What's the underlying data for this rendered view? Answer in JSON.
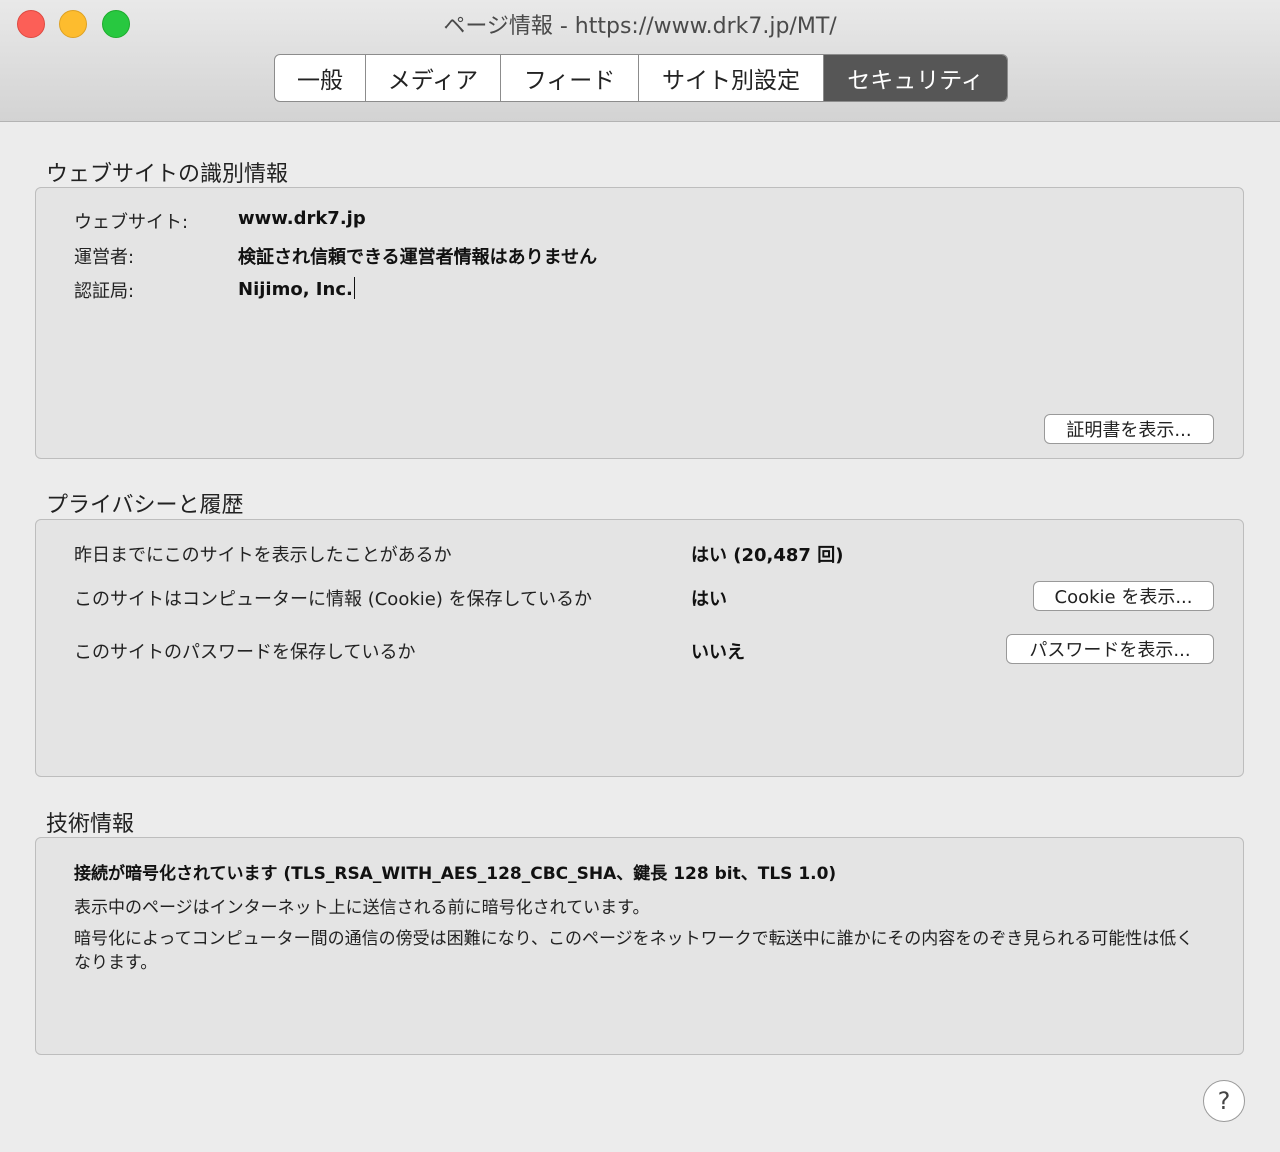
{
  "window": {
    "title": "ページ情報 - https://www.drk7.jp/MT/"
  },
  "tabs": [
    {
      "label": "一般",
      "active": false
    },
    {
      "label": "メディア",
      "active": false
    },
    {
      "label": "フィード",
      "active": false
    },
    {
      "label": "サイト別設定",
      "active": false
    },
    {
      "label": "セキュリティ",
      "active": true
    }
  ],
  "identity": {
    "title": "ウェブサイトの識別情報",
    "website_label": "ウェブサイト:",
    "website_value": "www.drk7.jp",
    "owner_label": "運営者:",
    "owner_value": "検証され信頼できる運営者情報はありません",
    "issuer_label": "認証局:",
    "issuer_value": "Nijimo, Inc.",
    "view_cert_button": "証明書を表示..."
  },
  "privacy": {
    "title": "プライバシーと履歴",
    "visited_question": "昨日までにこのサイトを表示したことがあるか",
    "visited_answer": "はい (20,487 回)",
    "cookie_question": "このサイトはコンピューターに情報 (Cookie) を保存しているか",
    "cookie_answer": "はい",
    "cookie_button": "Cookie を表示...",
    "password_question": "このサイトのパスワードを保存しているか",
    "password_answer": "いいえ",
    "password_button": "パスワードを表示..."
  },
  "technical": {
    "title": "技術情報",
    "headline": "接続が暗号化されています (TLS_RSA_WITH_AES_128_CBC_SHA、鍵長 128 bit、TLS 1.0)",
    "line1": "表示中のページはインターネット上に送信される前に暗号化されています。",
    "line2": "暗号化によってコンピューター間の通信の傍受は困難になり、このページをネットワークで転送中に誰かにその内容をのぞき見られる可能性は低くなります。"
  },
  "help_button": "?",
  "colors": {
    "active_tab": "#565656",
    "close": "#fc5f57",
    "minimize": "#fdbc2e",
    "maximize": "#28c840"
  }
}
